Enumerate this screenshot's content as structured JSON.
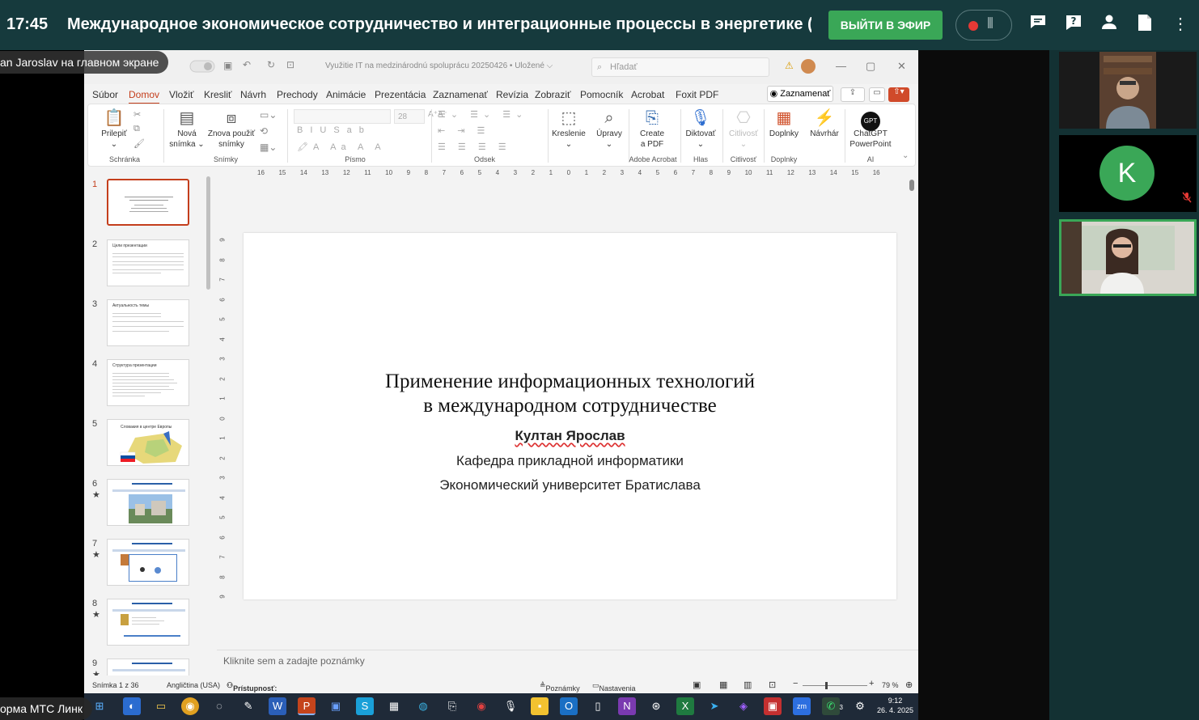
{
  "topbar": {
    "time": "17:45",
    "title": "Международное экономическое сотрудничество и интеграционные процессы в энергетике (Л",
    "live_button": "ВЫЙТИ В ЭФИР",
    "accent": "#3aa757",
    "icons": [
      "record-icon",
      "waveform-icon",
      "chat-icon",
      "help-icon",
      "person-icon",
      "document-icon",
      "more-icon"
    ]
  },
  "screen_label": "an Jaroslav на главном экране",
  "bottom_label": "орма МТС Линк",
  "participants": [
    {
      "initial": "K"
    }
  ],
  "ppt": {
    "doc_title": "Využitie IT na medzinárodnú spoluprácu 20250426 • Uložené ⌵",
    "search_placeholder": "Hľadať",
    "tabs": [
      "Súbor",
      "Domov",
      "Vložiť",
      "Kresliť",
      "Návrh",
      "Prechody",
      "Animácie",
      "Prezentácia",
      "Zaznamenať",
      "Revízia",
      "Zobraziť",
      "Pomocník",
      "Acrobat",
      "Foxit PDF"
    ],
    "active_tab": "Domov",
    "record_button": "Zaznamenať",
    "ribbon": {
      "paste": "Prilepiť",
      "new_slide_1": "Nová",
      "new_slide_2": "snímka",
      "reuse_1": "Znova použiť",
      "reuse_2": "snímky",
      "font_size": "28",
      "draw": "Kreslenie",
      "edit": "Úpravy",
      "create_pdf_1": "Create",
      "create_pdf_2": "a PDF",
      "dictate": "Diktovať",
      "sensitivity": "Citlivosť",
      "addins": "Doplnky",
      "designer": "Návrhár",
      "gpt_1": "ChatGPT",
      "gpt_2": "PowerPoint",
      "gpt_logo": "GPT",
      "groups": [
        "Schránka",
        "Snímky",
        "Písmo",
        "Odsek",
        "Adobe Acrobat",
        "Hlas",
        "Citlivosť",
        "Doplnky",
        "AI"
      ]
    },
    "thumbnails": [
      {
        "num": "1",
        "star": ""
      },
      {
        "num": "2",
        "star": ""
      },
      {
        "num": "3",
        "star": ""
      },
      {
        "num": "4",
        "star": ""
      },
      {
        "num": "5",
        "star": ""
      },
      {
        "num": "6",
        "star": "★"
      },
      {
        "num": "7",
        "star": "★"
      },
      {
        "num": "8",
        "star": "★"
      },
      {
        "num": "9",
        "star": "★"
      }
    ],
    "thumb_texts": {
      "t2": "Цели презентации",
      "t3": "Актуальность темы",
      "t4": "Структура презентации",
      "t5": "Словакия в центре Европы"
    },
    "slide": {
      "title_line1": "Применение информационных технологий",
      "title_line2": "в международном сотрудничестве",
      "author": "Култан Ярослав",
      "department": "Кафедра прикладной информатики",
      "university": "Экономический университет Братислава"
    },
    "notes_placeholder": "Kliknite sem a zadajte poznámky",
    "status": {
      "slide_count": "Snímka 1 z 36",
      "language": "Angličtina (USA)",
      "accessibility": "Prístupnosť: pozrite si odporúčania",
      "notes": "Poznámky",
      "view_settings": "Nastavenia zobrazenia",
      "zoom": "79 %"
    },
    "ruler_h": [
      "16",
      "15",
      "14",
      "13",
      "12",
      "11",
      "10",
      "9",
      "8",
      "7",
      "6",
      "5",
      "4",
      "3",
      "2",
      "1",
      "0",
      "1",
      "2",
      "3",
      "4",
      "5",
      "6",
      "7",
      "8",
      "9",
      "10",
      "11",
      "12",
      "13",
      "14",
      "15",
      "16"
    ],
    "ruler_v": [
      "9",
      "8",
      "7",
      "6",
      "5",
      "4",
      "3",
      "2",
      "1",
      "0",
      "1",
      "2",
      "3",
      "4",
      "5",
      "6",
      "7",
      "8",
      "9"
    ]
  },
  "taskbar": {
    "time": "9:12",
    "date": "26. 4. 2025",
    "badge": "3"
  }
}
